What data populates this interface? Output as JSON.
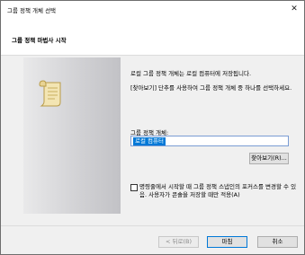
{
  "window": {
    "title": "그룹 정책 개체 선택"
  },
  "header": {
    "title": "그룹 정책 마법사 시작"
  },
  "content": {
    "intro": "로컬 그룹 정책 개체는 로컬 컴퓨터에 저장됩니다.",
    "description": "[찾아보기] 단추를 사용하여 그룹 정책 개체 중 하나를 선택하세요.",
    "gpo_label": "그룹 정책 개체:",
    "gpo_value": "로컬 컴퓨터",
    "browse_label": "찾아보기(R)...",
    "checkbox_label": "명령줄에서 시작할 때 그룹 정책 스냅인의 포커스를 변경할 수 있음. 사용자가 콘솔을 저장할 때만 적용(A)",
    "checkbox_checked": false
  },
  "buttons": {
    "back": "< 뒤로(B)",
    "finish": "마침",
    "cancel": "취소"
  },
  "icons": {
    "close": "close-icon",
    "scroll": "scroll-icon"
  }
}
